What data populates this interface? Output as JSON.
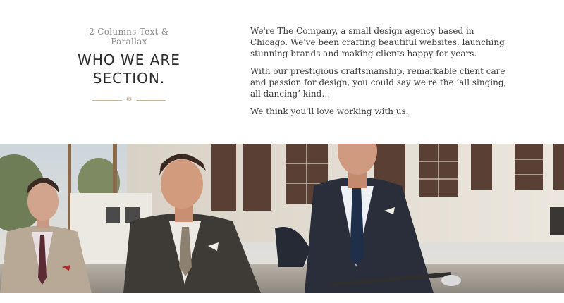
{
  "intro": {
    "eyebrow": "2 Columns Text & Parallax",
    "headline_line1": "WHO WE ARE",
    "headline_line2": "SECTION."
  },
  "body": {
    "paragraphs": [
      "We're The Company, a small design agency based in Chicago. We've been crafting beautiful websites, launching stunning brands and making clients happy for years.",
      "With our prestigious craftsmanship, remarkable client care and passion for design, you could say we're the ‘all singing, all dancing’ kind…",
      "We think you'll love working with us."
    ]
  },
  "colors": {
    "accent": "#c9b495",
    "heading": "#2b2b2b",
    "text": "#3a3a3a",
    "muted": "#8a8a8a"
  },
  "hero": {
    "image_icon": "photo-three-men-on-bikes"
  }
}
